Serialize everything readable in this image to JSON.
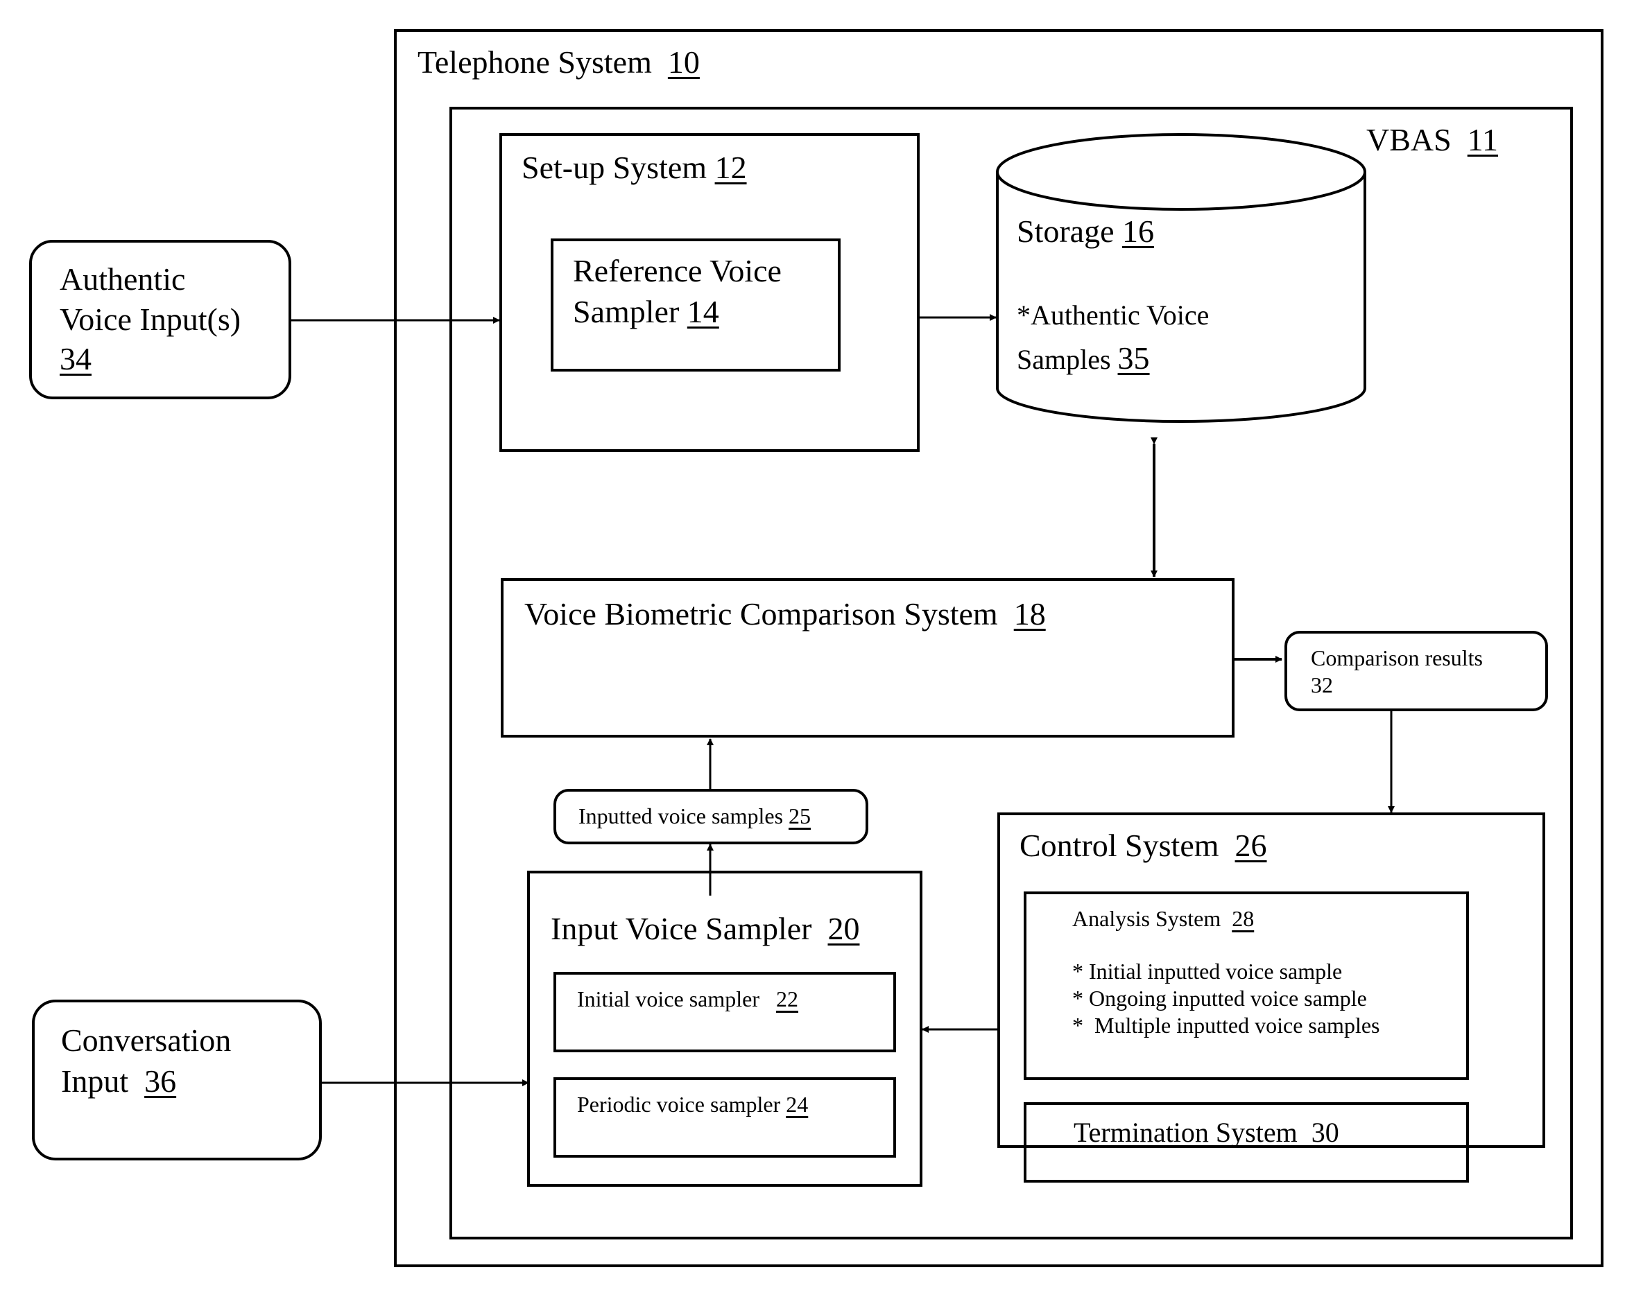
{
  "diagram": {
    "telephone_system": {
      "label": "Telephone System",
      "ref": "10"
    },
    "vbas": {
      "label": "VBAS",
      "ref": "11"
    },
    "setup_system": {
      "label": "Set-up System",
      "ref": "12"
    },
    "reference_voice_sampler": {
      "line1": "Reference Voice",
      "line2": "Sampler",
      "ref": "14"
    },
    "storage": {
      "label": "Storage",
      "ref": "16",
      "content_line1": "*Authentic Voice",
      "content_line2": "Samples",
      "content_ref": "35"
    },
    "authentic_voice_inputs": {
      "line1": "Authentic",
      "line2": "Voice Input(s)",
      "ref": "34"
    },
    "voice_biometric_comparison": {
      "label": "Voice Biometric Comparison System",
      "ref": "18"
    },
    "comparison_results": {
      "line1": "Comparison results",
      "line2": "32"
    },
    "inputted_voice_samples": {
      "label": "Inputted voice samples",
      "ref": "25"
    },
    "input_voice_sampler": {
      "label": "Input Voice Sampler",
      "ref": "20"
    },
    "initial_voice_sampler": {
      "label": "Initial voice sampler",
      "ref": "22"
    },
    "periodic_voice_sampler": {
      "label": "Periodic voice sampler",
      "ref": "24"
    },
    "conversation_input": {
      "line1": "Conversation",
      "line2": "Input",
      "ref": "36"
    },
    "control_system": {
      "label": "Control System",
      "ref": "26"
    },
    "analysis_system": {
      "label": "Analysis System",
      "ref": "28",
      "items": [
        "* Initial inputted voice sample",
        "* Ongoing inputted voice sample",
        "*  Multiple inputted voice samples"
      ]
    },
    "termination_system": {
      "label": "Termination System",
      "ref": "30"
    }
  }
}
